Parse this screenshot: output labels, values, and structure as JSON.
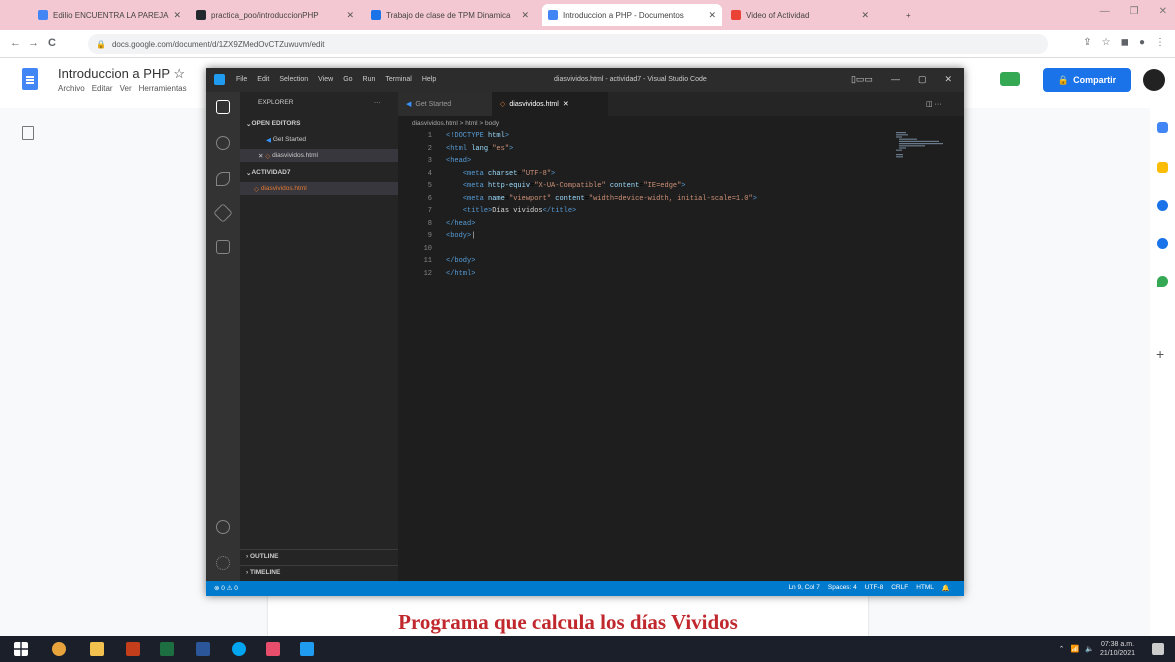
{
  "browser": {
    "tabs": [
      {
        "label": "Edilio ENCUENTRA LA PAREJA",
        "color": "#4285f4"
      },
      {
        "label": "practica_poo/introduccionPHP",
        "color": "#24292e"
      },
      {
        "label": "Trabajo de clase de TPM Dinamica",
        "color": "#1a73e8"
      },
      {
        "label": "Introduccion a PHP - Documentos",
        "color": "#4285f4",
        "active": true
      },
      {
        "label": "Video of Actividad",
        "color": "#ea4335"
      }
    ],
    "url": "docs.google.com/document/d/1ZX9ZMedOvCTZuwuvm/edit"
  },
  "docs": {
    "title": "Introduccion a PHP",
    "menu": [
      "Archivo",
      "Editar",
      "Ver",
      "Herramientas"
    ],
    "share_label": "Compartir",
    "page_text": "Programa que calcula los días Vividos"
  },
  "vscode": {
    "menu": [
      "File",
      "Edit",
      "Selection",
      "View",
      "Go",
      "Run",
      "Terminal",
      "Help"
    ],
    "window_title": "diasvividos.html - actividad7 - Visual Studio Code",
    "explorer_title": "EXPLORER",
    "open_editors": "OPEN EDITORS",
    "open_files": [
      "Get Started",
      "diasvividos.html"
    ],
    "folder": "ACTIVIDAD7",
    "folder_files": [
      "diasvividos.html"
    ],
    "outline": "OUTLINE",
    "timeline": "TIMELINE",
    "tabs": [
      "Get Started",
      "diasvividos.html"
    ],
    "breadcrumb": "diasvividos.html > html > body",
    "code_lines": [
      {
        "n": "1",
        "html": "<span class='tg'>&lt;!DOCTYPE</span> <span class='at'>html</span><span class='tg'>&gt;</span>"
      },
      {
        "n": "2",
        "html": "<span class='tg'>&lt;html</span> <span class='at'>lang</span>=<span class='st'>\"es\"</span><span class='tg'>&gt;</span>"
      },
      {
        "n": "3",
        "html": "<span class='tg'>&lt;head&gt;</span>"
      },
      {
        "n": "4",
        "html": "    <span class='tg'>&lt;meta</span> <span class='at'>charset</span>=<span class='st'>\"UTF-8\"</span><span class='tg'>&gt;</span>"
      },
      {
        "n": "5",
        "html": "    <span class='tg'>&lt;meta</span> <span class='at'>http-equiv</span>=<span class='st'>\"X-UA-Compatible\"</span> <span class='at'>content</span>=<span class='st'>\"IE=edge\"</span><span class='tg'>&gt;</span>"
      },
      {
        "n": "6",
        "html": "    <span class='tg'>&lt;meta</span> <span class='at'>name</span>=<span class='st'>\"viewport\"</span> <span class='at'>content</span>=<span class='st'>\"width=device-width, initial-scale=1.0\"</span><span class='tg'>&gt;</span>"
      },
      {
        "n": "7",
        "html": "    <span class='tg'>&lt;title&gt;</span><span class='tx'>Días vividos</span><span class='tg'>&lt;/title&gt;</span>"
      },
      {
        "n": "8",
        "html": "<span class='tg'>&lt;/head&gt;</span>"
      },
      {
        "n": "9",
        "html": "<span class='tg'>&lt;body&gt;</span><span class='tx'>|</span>"
      },
      {
        "n": "10",
        "html": ""
      },
      {
        "n": "11",
        "html": "<span class='tg'>&lt;/body&gt;</span>"
      },
      {
        "n": "12",
        "html": "<span class='tg'>&lt;/html&gt;</span>"
      }
    ],
    "status_left": "⊗ 0 ⚠ 0",
    "status_right": [
      "Ln 9, Col 7",
      "Spaces: 4",
      "UTF-8",
      "CRLF",
      "HTML"
    ]
  },
  "taskbar": {
    "time": "07:38 a.m.",
    "date": "21/10/2021"
  }
}
